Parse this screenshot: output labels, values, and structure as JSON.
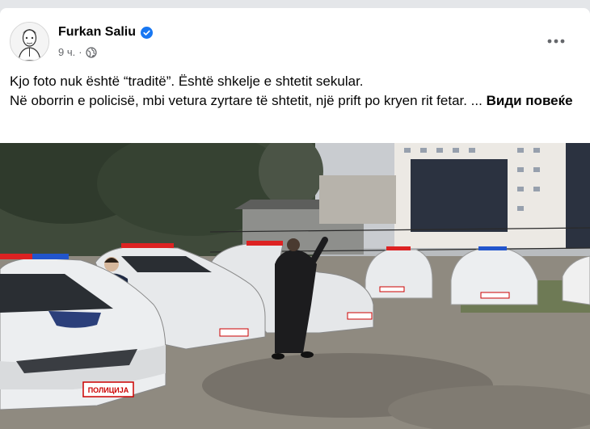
{
  "post": {
    "author": "Furkan Saliu",
    "time": "9 ч.",
    "separator": "·",
    "text_line1": "Kjo foto nuk është “traditë”. Është shkelje e shtetit sekular.",
    "text_line2": "Në oborrin e policisë, mbi vetura zyrtare të shtetit, një prift po kryen rit fetar. ...",
    "see_more": "Види повеќе",
    "plate_text": "ПОЛИЦИЈА"
  },
  "icons": {
    "verified": "verified-badge-icon",
    "audience": "globe-icon",
    "more": "more-options-icon"
  },
  "colors": {
    "verified": "#1877f2",
    "text": "#050505",
    "meta": "#65676b"
  }
}
